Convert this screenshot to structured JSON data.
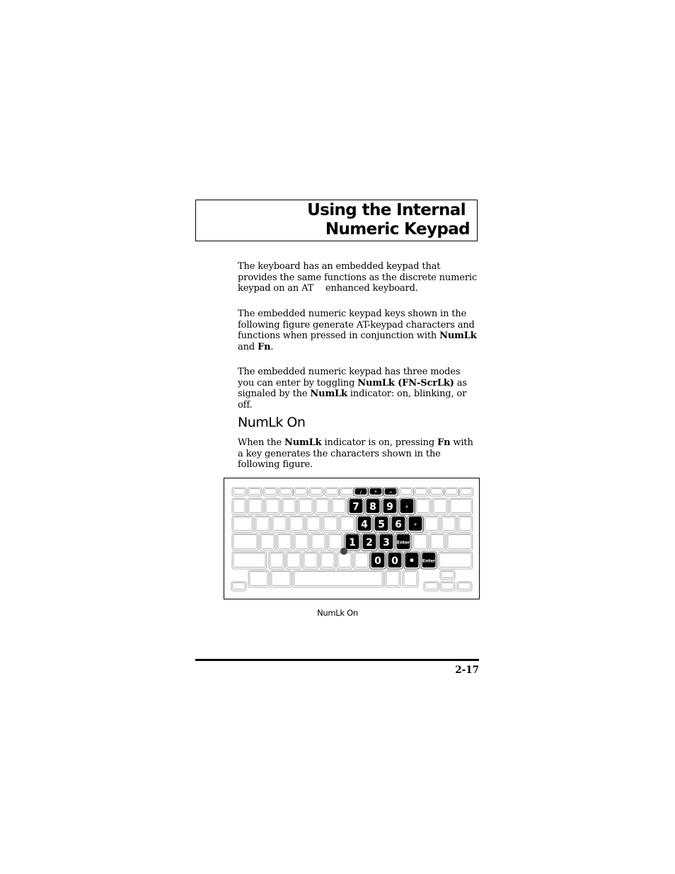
{
  "title": {
    "line1": "Using the Internal",
    "line2": "Numeric Keypad"
  },
  "paragraphs": [
    {
      "segments": [
        {
          "text": "The keyboard has an embedded keypad that provides the same functions as the discrete numeric keypad on an AT  enhanced keyboard.",
          "bold": false
        }
      ]
    },
    {
      "segments": [
        {
          "text": "The embedded numeric keypad keys shown in the following figure generate AT-keypad characters and functions when pressed in conjunction with ",
          "bold": false
        },
        {
          "text": "NumLk",
          "bold": true
        },
        {
          "text": " and ",
          "bold": false
        },
        {
          "text": "Fn",
          "bold": true
        },
        {
          "text": ".",
          "bold": false
        }
      ]
    },
    {
      "segments": [
        {
          "text": "The embedded numeric keypad has three modes you can enter by toggling ",
          "bold": false
        },
        {
          "text": "NumLk (FN-ScrLk)",
          "bold": true
        },
        {
          "text": " as signaled by the ",
          "bold": false
        },
        {
          "text": "NumLk",
          "bold": true
        },
        {
          "text": " indicator: on, blinking, or off.",
          "bold": false
        }
      ]
    }
  ],
  "section_heading": "NumLk On",
  "section_paragraph": {
    "segments": [
      {
        "text": "When the ",
        "bold": false
      },
      {
        "text": "NumLk",
        "bold": true
      },
      {
        "text": " indicator is on, pressing ",
        "bold": false
      },
      {
        "text": "Fn",
        "bold": true
      },
      {
        "text": " with a key generates the characters shown in the following figure.",
        "bold": false
      }
    ]
  },
  "figure": {
    "caption": "NumLk On",
    "highlighted_keys": {
      "function_row": [
        "/",
        "*",
        "−"
      ],
      "row1": [
        "7",
        "8",
        "9",
        "+"
      ],
      "row2": [
        "4",
        "5",
        "6",
        "+"
      ],
      "row3": [
        "1",
        "2",
        "3",
        "Enter"
      ],
      "row4": [
        "0",
        "0",
        "•",
        "Enter"
      ]
    },
    "colors": {
      "key_outline": "#9a9a9a",
      "highlight_fill": "#000000",
      "highlight_text": "#ffffff",
      "pointing_stick": "#444444"
    }
  },
  "footer": {
    "page_number": "2-17"
  }
}
